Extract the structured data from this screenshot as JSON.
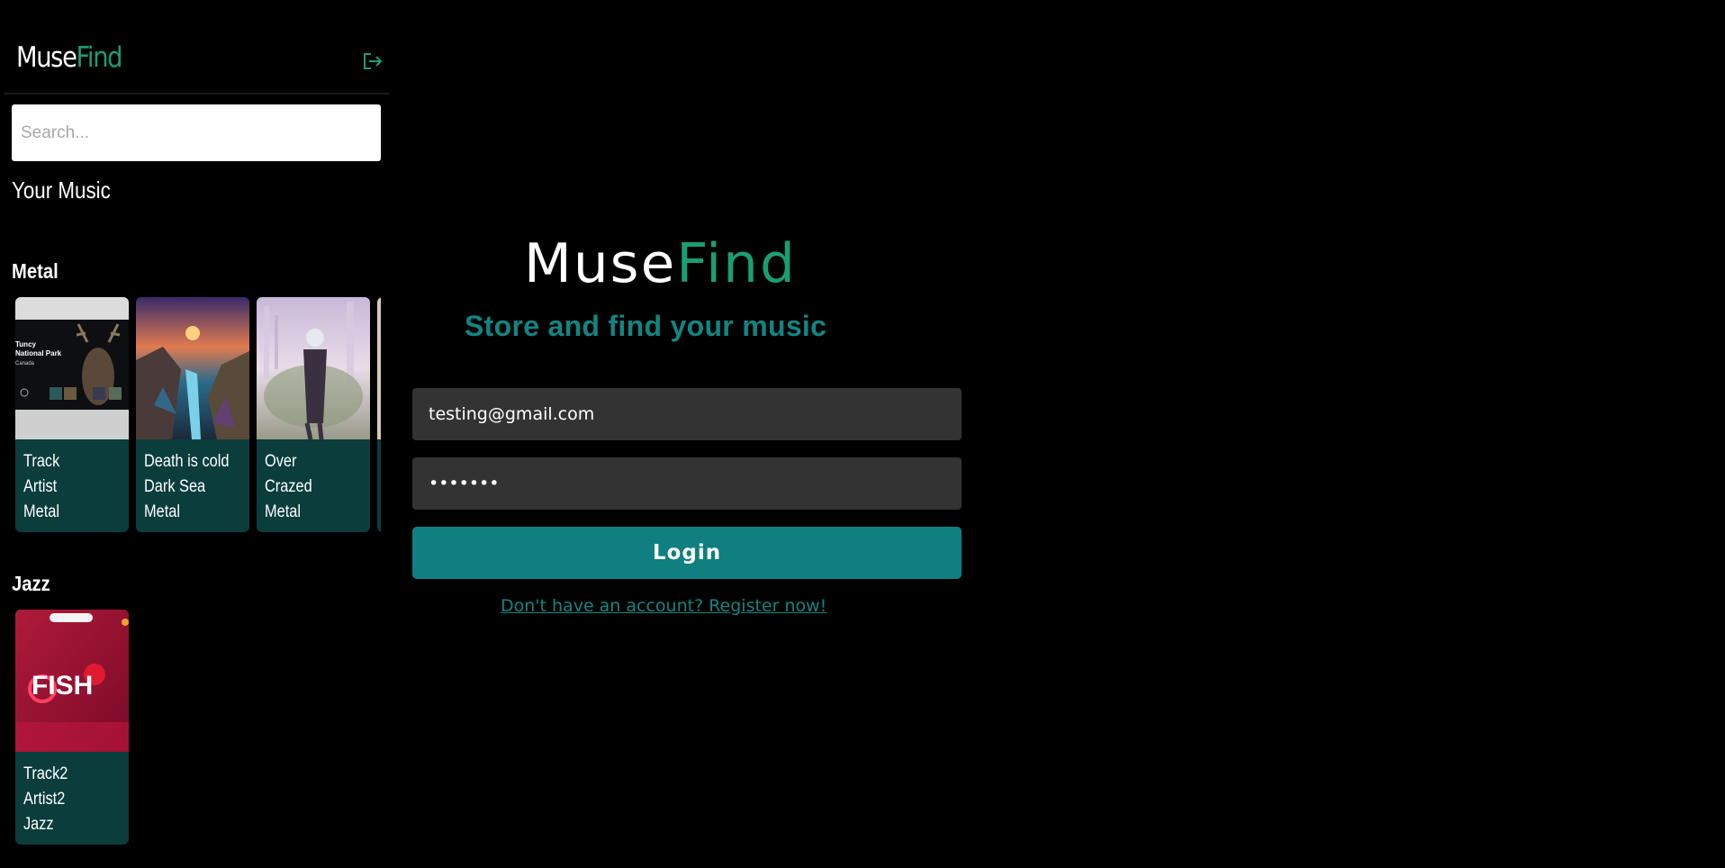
{
  "brand": {
    "name_part1": "Muse",
    "name_part2": "Find",
    "accent_color": "#1a9e73"
  },
  "sidebar": {
    "search": {
      "placeholder": "Search..."
    },
    "section_title": "Your Music",
    "logout_icon": "logout-icon",
    "genres": [
      {
        "name": "Metal",
        "tracks": [
          {
            "title": "Track",
            "artist": "Artist",
            "genre": "Metal",
            "cover_text": "Tuncy\nNational Park\nCanada"
          },
          {
            "title": "Death is cold",
            "artist": "Dark Sea",
            "genre": "Metal"
          },
          {
            "title": "Over",
            "artist": "Crazed",
            "genre": "Metal"
          }
        ]
      },
      {
        "name": "Jazz",
        "tracks": [
          {
            "title": "Track2",
            "artist": "Artist2",
            "genre": "Jazz",
            "cover_text": "FISH"
          }
        ]
      }
    ]
  },
  "login": {
    "tagline": "Store and find your music",
    "email_value": "testing@gmail.com",
    "password_value": "•••••••",
    "button_label": "Login",
    "register_link": "Don't have an account? Register now!",
    "tagline_color": "#128582",
    "button_color": "#0f7f7f"
  }
}
